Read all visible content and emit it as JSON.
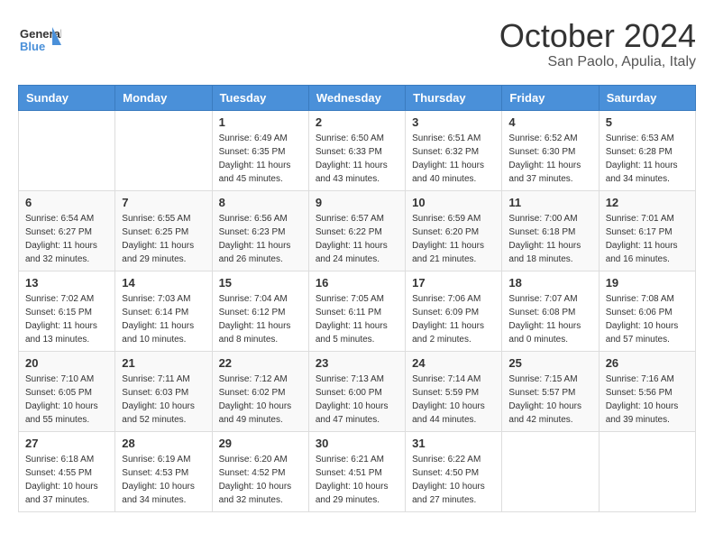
{
  "logo": {
    "line1": "General",
    "line2": "Blue"
  },
  "title": "October 2024",
  "subtitle": "San Paolo, Apulia, Italy",
  "days_of_week": [
    "Sunday",
    "Monday",
    "Tuesday",
    "Wednesday",
    "Thursday",
    "Friday",
    "Saturday"
  ],
  "weeks": [
    [
      {
        "day": "",
        "content": ""
      },
      {
        "day": "",
        "content": ""
      },
      {
        "day": "1",
        "content": "Sunrise: 6:49 AM\nSunset: 6:35 PM\nDaylight: 11 hours and 45 minutes."
      },
      {
        "day": "2",
        "content": "Sunrise: 6:50 AM\nSunset: 6:33 PM\nDaylight: 11 hours and 43 minutes."
      },
      {
        "day": "3",
        "content": "Sunrise: 6:51 AM\nSunset: 6:32 PM\nDaylight: 11 hours and 40 minutes."
      },
      {
        "day": "4",
        "content": "Sunrise: 6:52 AM\nSunset: 6:30 PM\nDaylight: 11 hours and 37 minutes."
      },
      {
        "day": "5",
        "content": "Sunrise: 6:53 AM\nSunset: 6:28 PM\nDaylight: 11 hours and 34 minutes."
      }
    ],
    [
      {
        "day": "6",
        "content": "Sunrise: 6:54 AM\nSunset: 6:27 PM\nDaylight: 11 hours and 32 minutes."
      },
      {
        "day": "7",
        "content": "Sunrise: 6:55 AM\nSunset: 6:25 PM\nDaylight: 11 hours and 29 minutes."
      },
      {
        "day": "8",
        "content": "Sunrise: 6:56 AM\nSunset: 6:23 PM\nDaylight: 11 hours and 26 minutes."
      },
      {
        "day": "9",
        "content": "Sunrise: 6:57 AM\nSunset: 6:22 PM\nDaylight: 11 hours and 24 minutes."
      },
      {
        "day": "10",
        "content": "Sunrise: 6:59 AM\nSunset: 6:20 PM\nDaylight: 11 hours and 21 minutes."
      },
      {
        "day": "11",
        "content": "Sunrise: 7:00 AM\nSunset: 6:18 PM\nDaylight: 11 hours and 18 minutes."
      },
      {
        "day": "12",
        "content": "Sunrise: 7:01 AM\nSunset: 6:17 PM\nDaylight: 11 hours and 16 minutes."
      }
    ],
    [
      {
        "day": "13",
        "content": "Sunrise: 7:02 AM\nSunset: 6:15 PM\nDaylight: 11 hours and 13 minutes."
      },
      {
        "day": "14",
        "content": "Sunrise: 7:03 AM\nSunset: 6:14 PM\nDaylight: 11 hours and 10 minutes."
      },
      {
        "day": "15",
        "content": "Sunrise: 7:04 AM\nSunset: 6:12 PM\nDaylight: 11 hours and 8 minutes."
      },
      {
        "day": "16",
        "content": "Sunrise: 7:05 AM\nSunset: 6:11 PM\nDaylight: 11 hours and 5 minutes."
      },
      {
        "day": "17",
        "content": "Sunrise: 7:06 AM\nSunset: 6:09 PM\nDaylight: 11 hours and 2 minutes."
      },
      {
        "day": "18",
        "content": "Sunrise: 7:07 AM\nSunset: 6:08 PM\nDaylight: 11 hours and 0 minutes."
      },
      {
        "day": "19",
        "content": "Sunrise: 7:08 AM\nSunset: 6:06 PM\nDaylight: 10 hours and 57 minutes."
      }
    ],
    [
      {
        "day": "20",
        "content": "Sunrise: 7:10 AM\nSunset: 6:05 PM\nDaylight: 10 hours and 55 minutes."
      },
      {
        "day": "21",
        "content": "Sunrise: 7:11 AM\nSunset: 6:03 PM\nDaylight: 10 hours and 52 minutes."
      },
      {
        "day": "22",
        "content": "Sunrise: 7:12 AM\nSunset: 6:02 PM\nDaylight: 10 hours and 49 minutes."
      },
      {
        "day": "23",
        "content": "Sunrise: 7:13 AM\nSunset: 6:00 PM\nDaylight: 10 hours and 47 minutes."
      },
      {
        "day": "24",
        "content": "Sunrise: 7:14 AM\nSunset: 5:59 PM\nDaylight: 10 hours and 44 minutes."
      },
      {
        "day": "25",
        "content": "Sunrise: 7:15 AM\nSunset: 5:57 PM\nDaylight: 10 hours and 42 minutes."
      },
      {
        "day": "26",
        "content": "Sunrise: 7:16 AM\nSunset: 5:56 PM\nDaylight: 10 hours and 39 minutes."
      }
    ],
    [
      {
        "day": "27",
        "content": "Sunrise: 6:18 AM\nSunset: 4:55 PM\nDaylight: 10 hours and 37 minutes."
      },
      {
        "day": "28",
        "content": "Sunrise: 6:19 AM\nSunset: 4:53 PM\nDaylight: 10 hours and 34 minutes."
      },
      {
        "day": "29",
        "content": "Sunrise: 6:20 AM\nSunset: 4:52 PM\nDaylight: 10 hours and 32 minutes."
      },
      {
        "day": "30",
        "content": "Sunrise: 6:21 AM\nSunset: 4:51 PM\nDaylight: 10 hours and 29 minutes."
      },
      {
        "day": "31",
        "content": "Sunrise: 6:22 AM\nSunset: 4:50 PM\nDaylight: 10 hours and 27 minutes."
      },
      {
        "day": "",
        "content": ""
      },
      {
        "day": "",
        "content": ""
      }
    ]
  ]
}
